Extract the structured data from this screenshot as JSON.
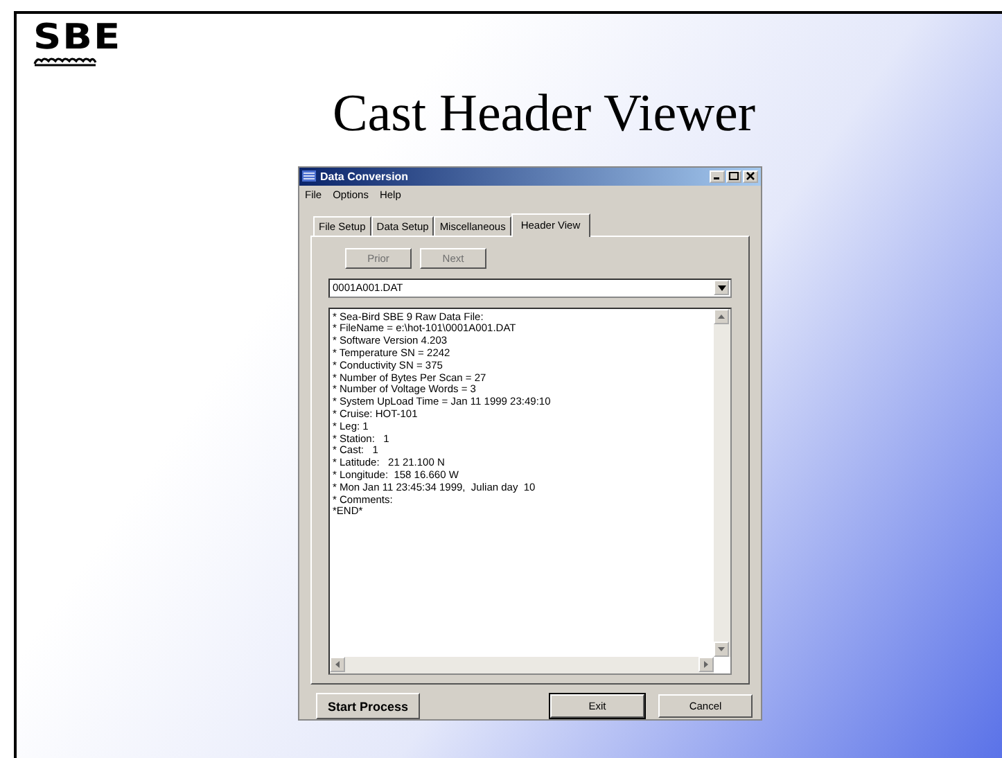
{
  "logo": {
    "text": "SBE"
  },
  "slide_title": "Cast Header Viewer",
  "window": {
    "title": "Data Conversion"
  },
  "menu": [
    "File",
    "Options",
    "Help"
  ],
  "tabs": [
    {
      "label": "File Setup",
      "selected": false
    },
    {
      "label": "Data Setup",
      "selected": false
    },
    {
      "label": "Miscellaneous",
      "selected": false
    },
    {
      "label": "Header View",
      "selected": true
    }
  ],
  "nav_buttons": [
    {
      "label": "Prior",
      "disabled": true
    },
    {
      "label": "Next",
      "disabled": true
    }
  ],
  "file_dropdown": {
    "value": "0001A001.DAT"
  },
  "header_lines": [
    "* Sea-Bird SBE 9 Raw Data File:",
    "* FileName = e:\\hot-101\\0001A001.DAT",
    "* Software Version 4.203",
    "* Temperature SN = 2242",
    "* Conductivity SN = 375",
    "* Number of Bytes Per Scan = 27",
    "* Number of Voltage Words = 3",
    "* System UpLoad Time = Jan 11 1999 23:49:10",
    "* Cruise: HOT-101",
    "* Leg: 1",
    "* Station:   1",
    "* Cast:   1",
    "* Latitude:   21 21.100 N",
    "* Longitude:  158 16.660 W",
    "* Mon Jan 11 23:45:34 1999,  Julian day  10",
    "* Comments:",
    "*END*"
  ],
  "start_button": "Start Process",
  "buttons": [
    "Exit",
    "Cancel"
  ]
}
